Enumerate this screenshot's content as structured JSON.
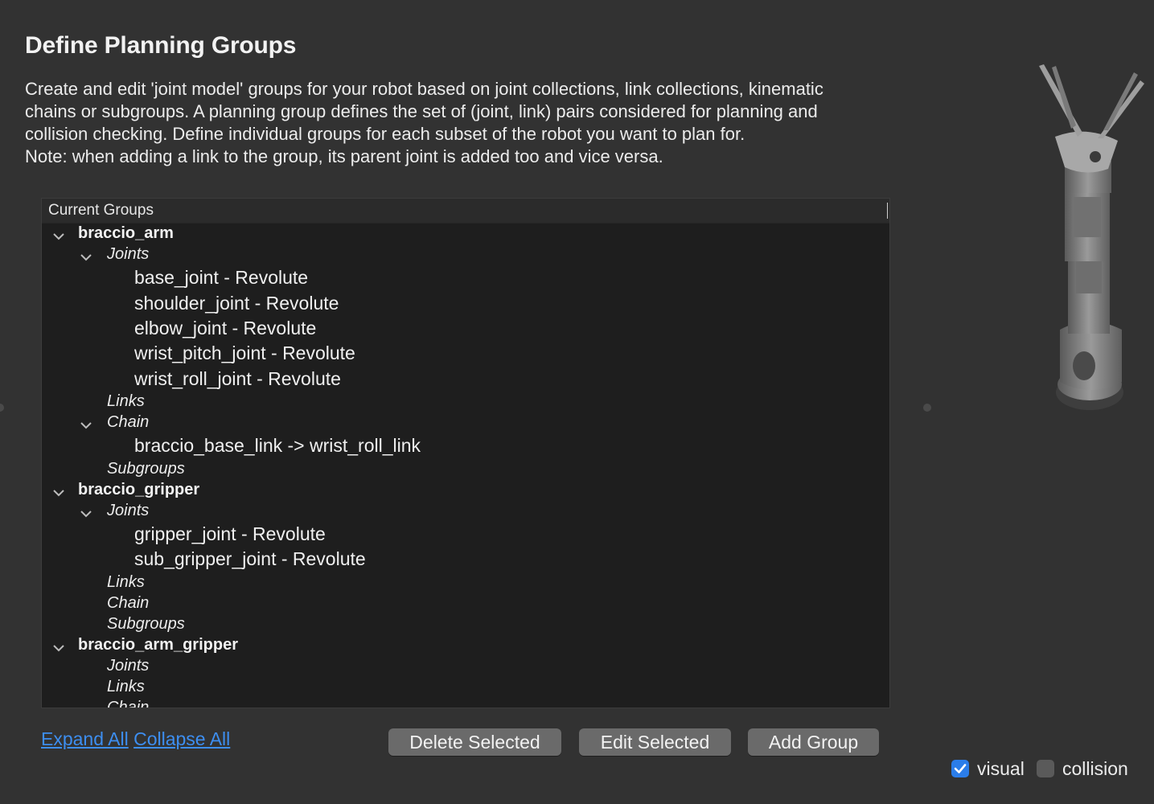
{
  "page": {
    "title": "Define Planning Groups",
    "description": [
      "Create and edit 'joint model' groups for your robot based on joint collections, link collections, kinematic",
      "chains or subgroups. A planning group defines the set of (joint, link) pairs considered for planning and",
      "collision checking. Define individual groups for each subset of the robot you want to plan for.",
      "Note: when adding a link to the group, its parent joint is added too and vice versa."
    ]
  },
  "tree": {
    "header": "Current Groups",
    "rows": [
      {
        "text": "braccio_arm"
      },
      {
        "text": "Joints"
      },
      {
        "text": "base_joint - Revolute"
      },
      {
        "text": "shoulder_joint - Revolute"
      },
      {
        "text": "elbow_joint - Revolute"
      },
      {
        "text": "wrist_pitch_joint - Revolute"
      },
      {
        "text": "wrist_roll_joint - Revolute"
      },
      {
        "text": "Links"
      },
      {
        "text": "Chain"
      },
      {
        "text": "braccio_base_link  ->  wrist_roll_link"
      },
      {
        "text": "Subgroups"
      },
      {
        "text": "braccio_gripper"
      },
      {
        "text": "Joints"
      },
      {
        "text": "gripper_joint - Revolute"
      },
      {
        "text": "sub_gripper_joint - Revolute"
      },
      {
        "text": "Links"
      },
      {
        "text": "Chain"
      },
      {
        "text": "Subgroups"
      },
      {
        "text": "braccio_arm_gripper"
      },
      {
        "text": "Joints"
      },
      {
        "text": "Links"
      },
      {
        "text": "Chain"
      }
    ]
  },
  "actions": {
    "expand_all": "Expand All",
    "collapse_all": "Collapse All",
    "delete_selected": "Delete Selected",
    "edit_selected": "Edit Selected",
    "add_group": "Add Group"
  },
  "view_options": {
    "visual_label": "visual",
    "visual_checked": true,
    "collision_label": "collision",
    "collision_checked": false
  },
  "colors": {
    "background": "#323232",
    "tree_background": "#1e1e1e",
    "link": "#3d8ef0",
    "checkbox_on": "#2b7de9",
    "button": "#6a6a6a"
  }
}
